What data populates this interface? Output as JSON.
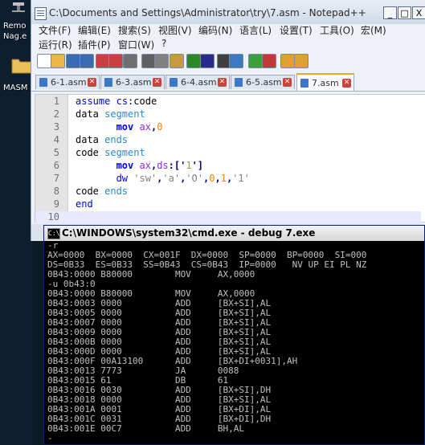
{
  "desktop": {
    "label1": "Remo",
    "label2": "Nag.e",
    "label3": "MASM"
  },
  "notepad": {
    "title": "C:\\Documents and Settings\\Administrator\\try\\7.asm - Notepad++",
    "window_buttons": {
      "minimize": "_",
      "maximize": "□",
      "close": "X"
    },
    "menu": [
      {
        "label": "文件(F)"
      },
      {
        "label": "编辑(E)"
      },
      {
        "label": "搜索(S)"
      },
      {
        "label": "视图(V)"
      },
      {
        "label": "编码(N)"
      },
      {
        "label": "语言(L)"
      },
      {
        "label": "设置(T)"
      },
      {
        "label": "工具(O)"
      },
      {
        "label": "宏(M)"
      },
      {
        "label": "运行(R)"
      },
      {
        "label": "插件(P)"
      },
      {
        "label": "窗口(W)"
      },
      {
        "label": "?"
      }
    ],
    "toolbar": [
      {
        "icon": "new-file-icon",
        "color": "#ffffff"
      },
      {
        "icon": "open-folder-icon",
        "color": "#e8b84a"
      },
      {
        "icon": "save-icon",
        "color": "#3a6ab0"
      },
      {
        "icon": "save-all-icon",
        "color": "#3a6ab0"
      },
      {
        "icon": "close-file-icon",
        "color": "#c84040"
      },
      {
        "icon": "close-all-icon",
        "color": "#c84040"
      },
      {
        "icon": "print-icon",
        "color": "#707070"
      },
      {
        "icon": "cut-icon",
        "color": "#606060"
      },
      {
        "icon": "copy-icon",
        "color": "#808080"
      },
      {
        "icon": "paste-icon",
        "color": "#c89a40"
      },
      {
        "icon": "undo-icon",
        "color": "#2a8a2a"
      },
      {
        "icon": "redo-icon",
        "color": "#2a2a8a"
      },
      {
        "icon": "find-icon",
        "color": "#404040"
      },
      {
        "icon": "replace-icon",
        "color": "#3a7ac0"
      },
      {
        "icon": "zoom-in-icon",
        "color": "#3aa03a"
      },
      {
        "icon": "zoom-out-icon",
        "color": "#c03a3a"
      },
      {
        "icon": "sync-v-icon",
        "color": "#e0a030"
      },
      {
        "icon": "sync-h-icon",
        "color": "#e0a030"
      }
    ],
    "tabs": [
      {
        "label": "6-1.asm",
        "active": false
      },
      {
        "label": "6-3.asm",
        "active": false
      },
      {
        "label": "6-4.asm",
        "active": false
      },
      {
        "label": "6-5.asm",
        "active": false
      },
      {
        "label": "7.asm",
        "active": true
      }
    ],
    "lines": [
      {
        "num": "1",
        "tokens": [
          [
            "kw",
            "assume"
          ],
          [
            "txt",
            " "
          ],
          [
            "kw",
            "cs"
          ],
          [
            "txt",
            ":code"
          ]
        ]
      },
      {
        "num": "2",
        "tokens": [
          [
            "txt",
            "data "
          ],
          [
            "seg",
            "segment"
          ]
        ]
      },
      {
        "num": "3",
        "tokens": [
          [
            "txt",
            "       "
          ],
          [
            "instr",
            "mov"
          ],
          [
            "txt",
            " "
          ],
          [
            "reg",
            "ax"
          ],
          [
            "op",
            ","
          ],
          [
            "num",
            "0"
          ]
        ]
      },
      {
        "num": "4",
        "tokens": [
          [
            "txt",
            "data "
          ],
          [
            "seg",
            "ends"
          ]
        ]
      },
      {
        "num": "5",
        "tokens": [
          [
            "txt",
            "code "
          ],
          [
            "seg",
            "segment"
          ]
        ]
      },
      {
        "num": "6",
        "tokens": [
          [
            "txt",
            "       "
          ],
          [
            "instr",
            "mov"
          ],
          [
            "txt",
            " "
          ],
          [
            "reg",
            "ax"
          ],
          [
            "op",
            ","
          ],
          [
            "reg",
            "ds"
          ],
          [
            "op",
            ":['"
          ],
          [
            "num",
            "1"
          ],
          [
            "op",
            "']"
          ]
        ]
      },
      {
        "num": "7",
        "tokens": [
          [
            "txt",
            "       "
          ],
          [
            "kw",
            "dw"
          ],
          [
            "txt",
            " "
          ],
          [
            "str",
            "'sw'"
          ],
          [
            "op",
            ","
          ],
          [
            "str",
            "'a'"
          ],
          [
            "op",
            ","
          ],
          [
            "str",
            "'O'"
          ],
          [
            "op",
            ","
          ],
          [
            "num",
            "0"
          ],
          [
            "op",
            ","
          ],
          [
            "num",
            "1"
          ],
          [
            "op",
            ","
          ],
          [
            "str",
            "'1'"
          ]
        ]
      },
      {
        "num": "8",
        "tokens": [
          [
            "txt",
            "code "
          ],
          [
            "seg",
            "ends"
          ]
        ]
      },
      {
        "num": "9",
        "tokens": [
          [
            "kw",
            "end"
          ]
        ]
      },
      {
        "num": "10",
        "tokens": []
      }
    ]
  },
  "cmd": {
    "title": "C:\\WINDOWS\\system32\\cmd.exe - debug 7.exe",
    "icon_text": "C:\\",
    "lines": [
      "-r",
      "AX=0000  BX=0000  CX=001F  DX=0000  SP=0000  BP=0000  SI=000",
      "DS=0B33  ES=0B33  SS=0B43  CS=0B43  IP=0000   NV UP EI PL NZ",
      "0B43:0000 B80000        MOV     AX,0000",
      "-u 0b43:0",
      "0B43:0000 B80000        MOV     AX,0000",
      "0B43:0003 0000          ADD     [BX+SI],AL",
      "0B43:0005 0000          ADD     [BX+SI],AL",
      "0B43:0007 0000          ADD     [BX+SI],AL",
      "0B43:0009 0000          ADD     [BX+SI],AL",
      "0B43:000B 0000          ADD     [BX+SI],AL",
      "0B43:000D 0000          ADD     [BX+SI],AL",
      "0B43:000F 00A13100      ADD     [BX+DI+0031],AH",
      "0B43:0013 7773          JA      0088",
      "0B43:0015 61            DB      61",
      "0B43:0016 0030          ADD     [BX+SI],DH",
      "0B43:0018 0000          ADD     [BX+SI],AL",
      "0B43:001A 0001          ADD     [BX+DI],AL",
      "0B43:001C 0031          ADD     [BX+DI],DH",
      "0B43:001E 00C7          ADD     BH,AL",
      "-"
    ]
  }
}
